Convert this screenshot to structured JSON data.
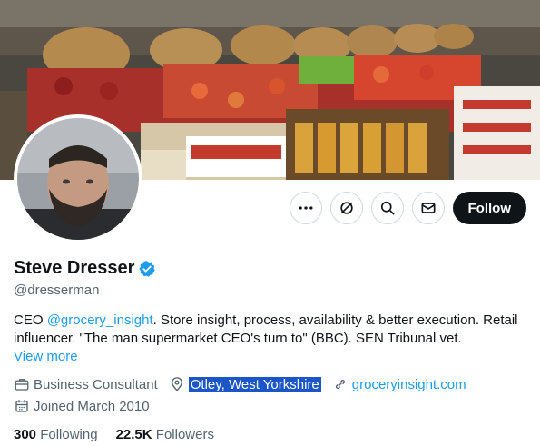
{
  "banner": {
    "icon": "grocery-apples-display-photo"
  },
  "avatar": {
    "icon": "bearded-man-portrait"
  },
  "actions": {
    "more_icon": "more-icon",
    "grok_icon": "grok-icon",
    "search_icon": "search-icon",
    "message_icon": "message-icon",
    "follow_label": "Follow"
  },
  "profile": {
    "name": "Steve Dresser",
    "handle": "@dresserman",
    "bio_prefix": "CEO ",
    "bio_mention": "@grocery_insight",
    "bio_rest": ". Store insight, process, availability & better execution. Retail influencer. \"The man supermarket CEO's turn to\" (BBC). SEN Tribunal vet.",
    "view_more": "View more",
    "category": "Business Consultant",
    "location": "Otley, West Yorkshire",
    "website": "groceryinsight.com",
    "joined": "Joined March 2010"
  },
  "stats": {
    "following_count": "300",
    "following_label": "Following",
    "followers_count": "22.5K",
    "followers_label": "Followers"
  },
  "colors": {
    "accent": "#1d9bf0",
    "text": "#0f1419",
    "muted": "#536471",
    "selection": "#1a56c8"
  }
}
